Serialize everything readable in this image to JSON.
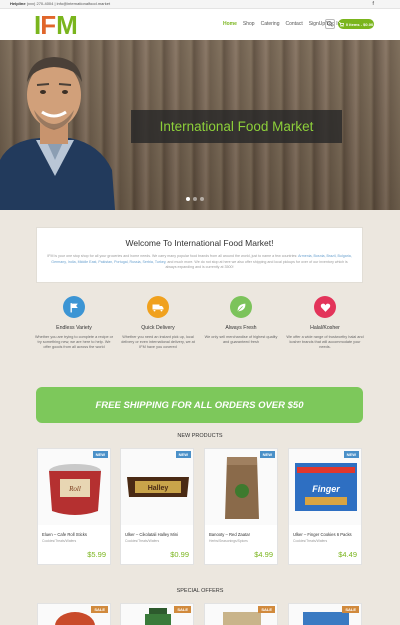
{
  "topbar": {
    "helpline_label": "Helpline",
    "helpline_text": "(xxx) 270-4004 | info@internationalfood.market",
    "social": "f"
  },
  "brand": {
    "logo_left": "I",
    "logo_mid": "F",
    "logo_right": "M"
  },
  "nav": {
    "items": [
      "Home",
      "Shop",
      "Catering",
      "Contact",
      "SignUp/Log In"
    ],
    "active": "Home"
  },
  "cart": {
    "label": "0 items - $0.00"
  },
  "hero": {
    "title": "International Food Market",
    "slides": 3,
    "active_slide": 1
  },
  "welcome": {
    "title": "Welcome To International Food Market!",
    "text_a": "IFM is your one stop shop for all your groceries and home needs. We carry many popular food brands from all around the world, just to name a few countries:",
    "countries": "Armenia, Bosnia, Brazil, Bulgaria, Germany, India, Middle East, Pakistan, Portugal, Russia, Serbia, Turkey,",
    "text_b": "and much more. We do not stop at here we also offer shipping and local pickups for over of our inventory which is always expanding and is currently at 3500!"
  },
  "features": [
    {
      "title": "Endless Variety",
      "text": "Whether you are trying to complete a recipe or try something new, we are here to help. We offer goods from all across the world",
      "icon": "flag-icon",
      "color": "#3c95d4"
    },
    {
      "title": "Quick Delivery",
      "text": "Whether you need an instant pick up, local delivery or even international delivery, we at IFM have you covered",
      "icon": "truck-icon",
      "color": "#f0a11e"
    },
    {
      "title": "Always Fresh",
      "text": "We only sell merchandise of highest quality and guaranteed fresh",
      "icon": "leaf-icon",
      "color": "#7cc35b"
    },
    {
      "title": "Halal/Kosher",
      "text": "We offer a wide range of trustworthy halal and kosher brands that will accommodate your needs.",
      "icon": "heart-icon",
      "color": "#e3345a"
    }
  ],
  "promo": {
    "text": "FREE SHIPPING FOR ALL ORDERS OVER $50"
  },
  "new_products": {
    "title": "NEW PRODUCTS",
    "items": [
      {
        "badge": "NEW",
        "name": "Eluen – Cafe Roll Sticks",
        "category": "Cookies/Treats/Wafers",
        "price": "$5.99",
        "img": "tub"
      },
      {
        "badge": "NEW",
        "name": "Ulker – Cikolatali Halley Mini",
        "category": "Cookies/Treats/Wafers",
        "price": "$0.99",
        "img": "bar"
      },
      {
        "badge": "NEW",
        "name": "Banooty – Red Zaatar",
        "category": "Herbs/Seasonings/Spices",
        "price": "$4.99",
        "img": "bag"
      },
      {
        "badge": "NEW",
        "name": "Ulker – Finger Cookies 6 Packs",
        "category": "Cookies/Treats/Wafers",
        "price": "$4.49",
        "img": "pack"
      }
    ]
  },
  "special_offers": {
    "title": "SPECIAL OFFERS",
    "items": [
      {
        "badge": "SALE"
      },
      {
        "badge": "SALE"
      },
      {
        "badge": "SALE"
      },
      {
        "badge": "SALE"
      }
    ]
  }
}
